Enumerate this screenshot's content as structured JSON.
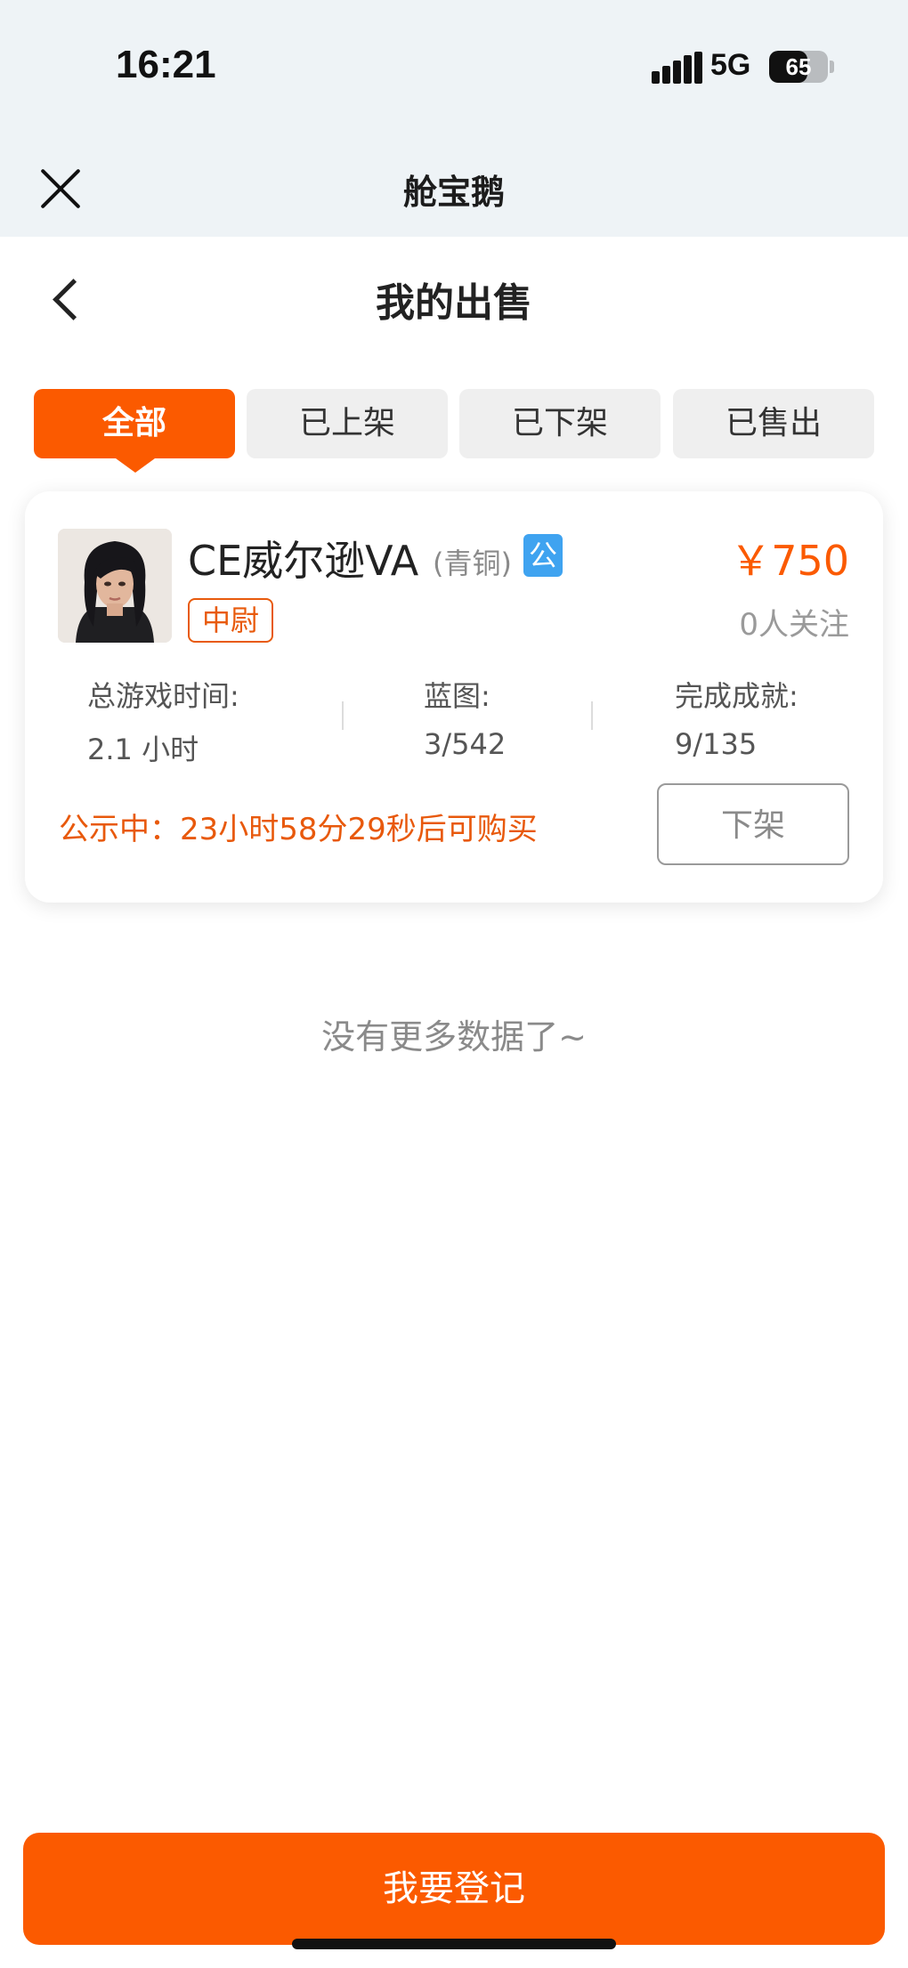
{
  "status_bar": {
    "time": "16:21",
    "network": "5G",
    "battery_level": "65",
    "battery_fraction": 0.65
  },
  "miniapp": {
    "title": "舱宝鹅",
    "close_icon": "close-icon"
  },
  "header": {
    "title": "我的出售",
    "back_icon": "chevron-left-icon"
  },
  "tabs": [
    {
      "label": "全部",
      "active": true
    },
    {
      "label": "已上架",
      "active": false
    },
    {
      "label": "已下架",
      "active": false
    },
    {
      "label": "已售出",
      "active": false
    }
  ],
  "listing": {
    "name": "CE威尔逊VA",
    "grade": "(青铜)",
    "badge": "公",
    "rank_tag": "中尉",
    "price": "￥750",
    "followers": "0人关注",
    "stats": [
      {
        "label": "总游戏时间:",
        "value": "2.1 小时"
      },
      {
        "label": "蓝图:",
        "value": "3/542"
      },
      {
        "label": "完成成就:",
        "value": "9/135"
      }
    ],
    "notice": "公示中：23小时58分29秒后可购买",
    "delist_label": "下架"
  },
  "list_end_text": "没有更多数据了~",
  "footer": {
    "register_label": "我要登记"
  },
  "colors": {
    "accent": "#fb5a00",
    "badge_blue": "#3fa3f0",
    "header_bg": "#eef3f6"
  }
}
